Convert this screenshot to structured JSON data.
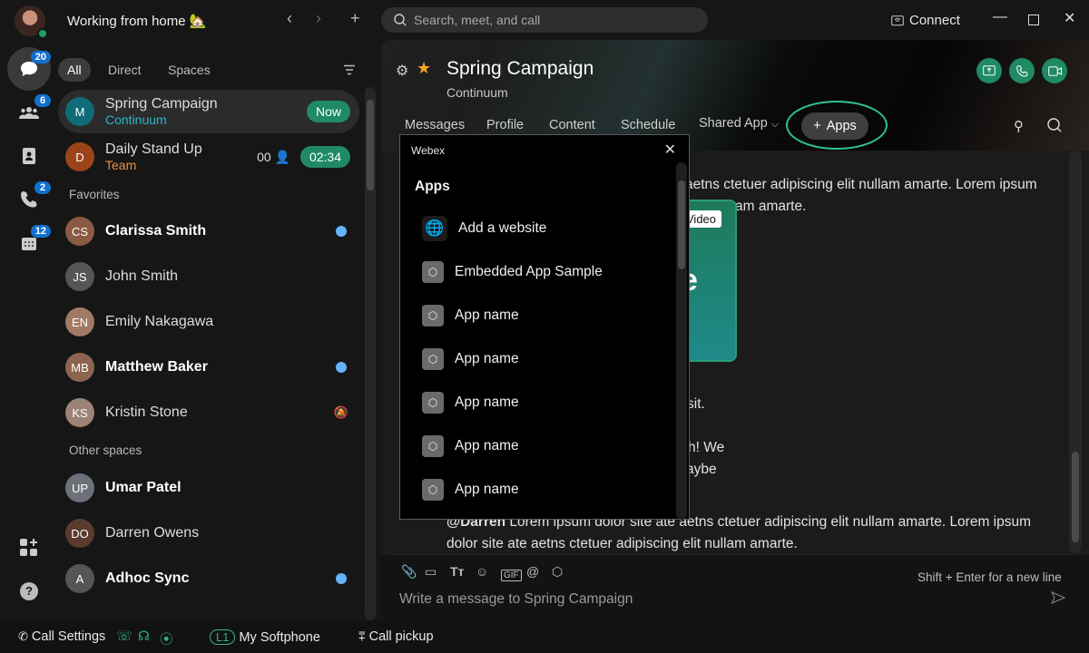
{
  "titlebar": {
    "status": "Working from home 🏡",
    "search_placeholder": "Search, meet, and call",
    "connect": "Connect",
    "back": "‹",
    "forward": "›",
    "new": "+"
  },
  "rail": [
    {
      "icon": "messaging-icon",
      "badge": "20"
    },
    {
      "icon": "teams-icon",
      "badge": "6"
    },
    {
      "icon": "contacts-icon",
      "badge": ""
    },
    {
      "icon": "calling-icon",
      "badge": "2"
    },
    {
      "icon": "meetings-icon",
      "badge": "12"
    }
  ],
  "filters": [
    "All",
    "Direct",
    "Spaces"
  ],
  "list": {
    "active": [
      {
        "initial": "M",
        "name": "Spring Campaign",
        "sub": "Continuum",
        "sub_color": "#2bb5c8",
        "avatar_color": "#0f6b78",
        "pill": "Now"
      },
      {
        "initial": "D",
        "name": "Daily Stand Up",
        "sub": "Team",
        "sub_color": "#e98f45",
        "avatar_color": "#9c4419",
        "count": "00",
        "pill": "02:34"
      }
    ],
    "favorites_label": "Favorites",
    "favorites": [
      {
        "initial": "CS",
        "name": "Clarissa Smith",
        "bold": true,
        "unread": true,
        "status": "active",
        "avatar_color": "#8a5a44"
      },
      {
        "initial": "JS",
        "name": "John Smith",
        "bold": false,
        "unread": false,
        "status": "",
        "avatar_color": "#555"
      },
      {
        "initial": "EN",
        "name": "Emily Nakagawa",
        "bold": false,
        "unread": false,
        "status": "video",
        "avatar_color": "#a07a62"
      },
      {
        "initial": "MB",
        "name": "Matthew Baker",
        "bold": true,
        "unread": true,
        "status": "dnd",
        "avatar_color": "#8d6450"
      },
      {
        "initial": "KS",
        "name": "Kristin Stone",
        "bold": false,
        "unread": false,
        "status": "away",
        "muted": true,
        "avatar_color": "#9b8376"
      }
    ],
    "other_label": "Other spaces",
    "other": [
      {
        "initial": "UP",
        "name": "Umar Patel",
        "bold": true,
        "unread": false,
        "status": "presenting",
        "avatar_color": "#6c7078"
      },
      {
        "initial": "DO",
        "name": "Darren Owens",
        "bold": false,
        "unread": false,
        "status": "meeting",
        "avatar_color": "#5a3b2e"
      },
      {
        "initial": "A",
        "name": "Adhoc Sync",
        "bold": true,
        "unread": true,
        "status": "",
        "avatar_color": "#555"
      }
    ]
  },
  "space": {
    "title": "Spring Campaign",
    "subtitle": "Continuum",
    "tabs": [
      "Messages",
      "Profile",
      "Content",
      "Schedule",
      "Shared App"
    ],
    "apps_button": "Apps"
  },
  "messages": {
    "line1": "aetns ctetuer adipiscing elit nullam amarte. Lorem ipsum",
    "line2": "am amarte.",
    "video_label": "Video",
    "card_letter": "e",
    "frag1": "sit.",
    "frag2": "h! We",
    "frag3": "aybe",
    "mention": "@Darren",
    "last1": " Lorem ipsum dolor site ate aetns ctetuer adipiscing elit nullam amarte. Lorem ipsum",
    "last2": "dolor site ate aetns ctetuer adipiscing elit nullam amarte."
  },
  "popup": {
    "window_title": "Webex",
    "heading": "Apps",
    "items": [
      {
        "label": "Add a website",
        "icon": "globe-icon"
      },
      {
        "label": "Embedded App Sample",
        "icon": "app-icon"
      },
      {
        "label": "App name",
        "icon": "app-icon"
      },
      {
        "label": "App name",
        "icon": "app-icon"
      },
      {
        "label": "App name",
        "icon": "app-icon"
      },
      {
        "label": "App name",
        "icon": "app-icon"
      },
      {
        "label": "App name",
        "icon": "app-icon"
      }
    ]
  },
  "composer": {
    "placeholder": "Write a message to Spring Campaign",
    "hint": "Shift + Enter for a new line"
  },
  "footer": {
    "call_settings": "Call Settings",
    "line": "L1",
    "softphone": "My Softphone",
    "pickup": "Call pickup"
  },
  "colors": {
    "accent": "#1f8a63",
    "unread": "#64b4fa",
    "badge": "#1170cf",
    "highlight_ring": "#2fc197"
  }
}
